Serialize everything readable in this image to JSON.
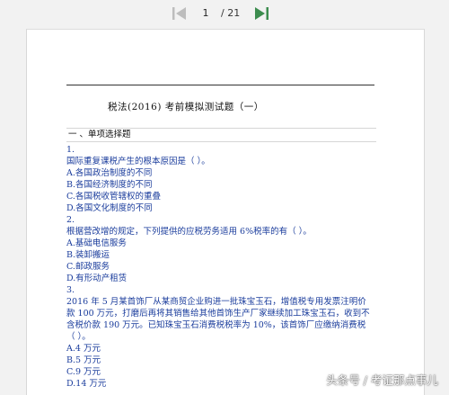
{
  "viewer": {
    "current_page": "1",
    "total_pages": "/ 21",
    "prev_icon": "arrow-left-icon",
    "next_icon": "arrow-right-icon",
    "prev_color": "#bdbdbd",
    "next_color": "#3c8c4e"
  },
  "document": {
    "title": "税法(2016) 考前模拟测试题（一）",
    "section_heading": "一 、单项选择题",
    "questions": [
      {
        "number": "1.",
        "stem": [
          "国际重复课税产生的根本原因是（  ）。"
        ],
        "options": [
          "A.各国政治制度的不同",
          "B.各国经济制度的不同",
          "C.各国税收管辖权的重叠",
          "D.各国文化制度的不同"
        ]
      },
      {
        "number": "2.",
        "stem": [
          "根据营改增的规定，下列提供的应税劳务适用 6%税率的有（  ）。"
        ],
        "options": [
          "A.基础电信服务",
          "B.装卸搬运",
          "C.邮政服务",
          "D.有形动产租赁"
        ]
      },
      {
        "number": "3.",
        "stem": [
          "2016 年 5 月某首饰厂从某商贸企业购进一批珠宝玉石，增值税专用发票注明价",
          "款 100 万元，打磨后再将其销售给其他首饰生产厂家继续加工珠宝玉石，收到不",
          "含税价款 190 万元。已知珠宝玉石消费税税率为 10%，该首饰厂应缴纳消费税",
          "（  ）。"
        ],
        "options": [
          "A.4 万元",
          "B.5 万元",
          "C.9 万元",
          "D.14 万元"
        ]
      }
    ]
  },
  "watermark": {
    "text": "头条号 / 考证那点事儿"
  }
}
